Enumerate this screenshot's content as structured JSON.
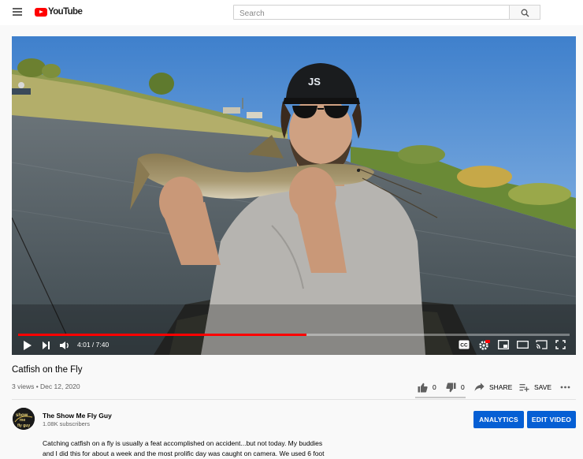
{
  "masthead": {
    "logo_text": "YouTube",
    "search_placeholder": "Search"
  },
  "player": {
    "time_current": "4:01",
    "time_total": "7:40",
    "time_display": "4:01 / 7:40",
    "progress": 0.523,
    "cap_text": "JS"
  },
  "video": {
    "title": "Catfish on the Fly",
    "views": "3 views",
    "date": "Dec 12, 2020",
    "meta": "3 views • Dec 12, 2020"
  },
  "actions": {
    "likes": "0",
    "dislikes": "0",
    "share_label": "SHARE",
    "save_label": "SAVE"
  },
  "channel": {
    "name": "The Show Me Fly Guy",
    "subscribers": "1.08K subscribers",
    "avatar_text_top": "show",
    "avatar_text_mid": "me",
    "avatar_text_bot": "fly guy"
  },
  "buttons": {
    "analytics": "ANALYTICS",
    "edit_video": "EDIT VIDEO"
  },
  "description": {
    "line1": "Catching catfish on a fly is usually a feat accomplished on accident...but not today.  My buddies",
    "line2": "and I did this for about a week and the most prolific day was caught on camera.  We used 6 foot"
  },
  "colors": {
    "brand_red": "#ff0000",
    "button_blue": "#065fd4",
    "text_primary": "#030303",
    "text_secondary": "#606060"
  }
}
